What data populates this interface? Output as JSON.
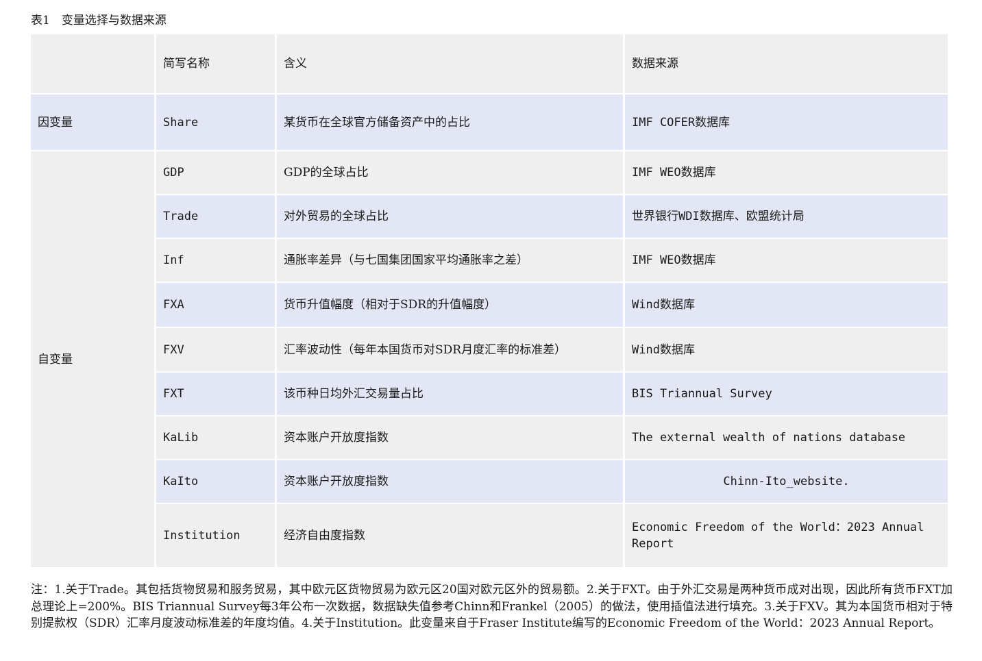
{
  "caption": "表1　变量选择与数据来源",
  "headers": [
    "",
    "简写名称",
    "含义",
    "数据来源"
  ],
  "dependent": {
    "group": "因变量",
    "abbr": "Share",
    "meaning": "某货币在全球官方储备资产中的占比",
    "source": "IMF COFER数据库"
  },
  "independent_group": "自变量",
  "rows": [
    {
      "abbr": "GDP",
      "meaning": "GDP的全球占比",
      "source": "IMF WEO数据库"
    },
    {
      "abbr": "Trade",
      "meaning": "对外贸易的全球占比",
      "source": "世界银行WDI数据库、欧盟统计局"
    },
    {
      "abbr": "Inf",
      "meaning": "通胀率差异（与七国集团国家平均通胀率之差）",
      "source": "IMF WEO数据库"
    },
    {
      "abbr": "FXA",
      "meaning": "货币升值幅度（相对于SDR的升值幅度）",
      "source": "Wind数据库"
    },
    {
      "abbr": "FXV",
      "meaning": "汇率波动性（每年本国货币对SDR月度汇率的标准差）",
      "source": "Wind数据库"
    },
    {
      "abbr": "FXT",
      "meaning": "该币种日均外汇交易量占比",
      "source": "BIS Triannual Survey"
    },
    {
      "abbr": "KaLib",
      "meaning": "资本账户开放度指数",
      "source": "The external wealth of nations database"
    },
    {
      "abbr": "KaIto",
      "meaning": "资本账户开放度指数",
      "source": "Chinn-Ito_website."
    },
    {
      "abbr": "Institution",
      "meaning": "经济自由度指数",
      "source": "Economic Freedom of the World：2023 Annual Report"
    }
  ],
  "note": "注：1.关于Trade。其包括货物贸易和服务贸易，其中欧元区货物贸易为欧元区20国对欧元区外的贸易额。2.关于FXT。由于外汇交易是两种货币成对出现，因此所有货币FXT加总理论上=200%。BIS Triannual Survey每3年公布一次数据，数据缺失值参考Chinn和Frankel（2005）的做法，使用插值法进行填充。3.关于FXV。其为本国货币相对于特别提款权（SDR）汇率月度波动标准差的年度均值。4.关于Institution。此变量来自于Fraser Institute编写的Economic Freedom of the World：2023 Annual Report。"
}
